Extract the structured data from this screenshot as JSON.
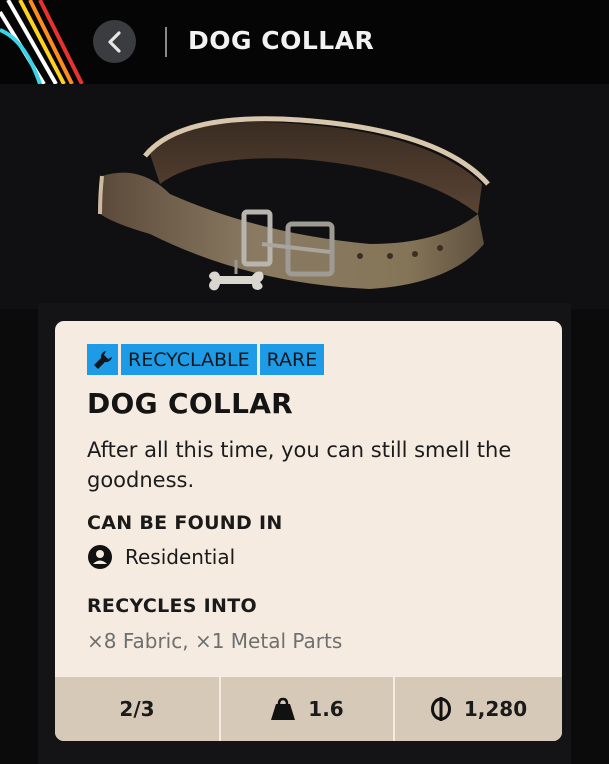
{
  "header": {
    "title": "DOG COLLAR",
    "stripe_colors": [
      "#ffffff",
      "#39d4e8",
      "#ffd21e",
      "#ff8a1e",
      "#e8322b"
    ]
  },
  "item": {
    "tags": [
      "RECYCLABLE",
      "RARE"
    ],
    "tag_color": "#1e9be6",
    "name": "DOG COLLAR",
    "description": "After all this time, you can still smell the goodness.",
    "found_in_label": "CAN BE FOUND IN",
    "found_in": "Residential",
    "recycles_label": "RECYCLES INTO",
    "recycles_into": "×8 Fabric, ×1 Metal Parts",
    "stats": {
      "stack": "2/3",
      "weight": "1.6",
      "value": "1,280"
    }
  },
  "icons": {
    "back": "chevron-left-icon",
    "tag": "wrench-icon",
    "location": "person-icon",
    "weight": "weight-icon",
    "currency": "coin-icon"
  }
}
